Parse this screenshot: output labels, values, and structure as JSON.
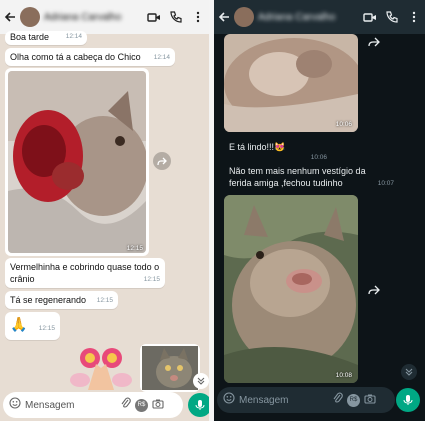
{
  "left": {
    "header": {
      "contact_name": "Adriana Carvalho"
    },
    "messages": [
      {
        "text": "Boa tarde",
        "time": "12:14"
      },
      {
        "text": "Olha como tá a cabeça do Chico",
        "time": "12:14"
      },
      {
        "photo_time": "12:15"
      },
      {
        "text": "Vermelhinha e cobrindo quase todo o crânio",
        "time": "12:15"
      },
      {
        "text": "Tá se regenerando",
        "time": "12:15"
      },
      {
        "text": "🙏",
        "time": "12:15"
      }
    ],
    "input": {
      "placeholder": "Mensagem"
    }
  },
  "right": {
    "header": {
      "contact_name": "Adriana Carvalho"
    },
    "messages": [
      {
        "photo_time": "10:06"
      },
      {
        "text": "E tá lindo!!!😻",
        "time": "10:06"
      },
      {
        "text": "Não tem mais nenhum vestígio da ferida amiga ,fechou tudinho",
        "time": "10:07"
      },
      {
        "photo_time": "10:08"
      }
    ],
    "input": {
      "placeholder": "Mensagem"
    }
  },
  "colors": {
    "accent": "#00a884",
    "chat_bg_light": "#e7ddd3",
    "chat_bg_dark": "#0d1418"
  }
}
